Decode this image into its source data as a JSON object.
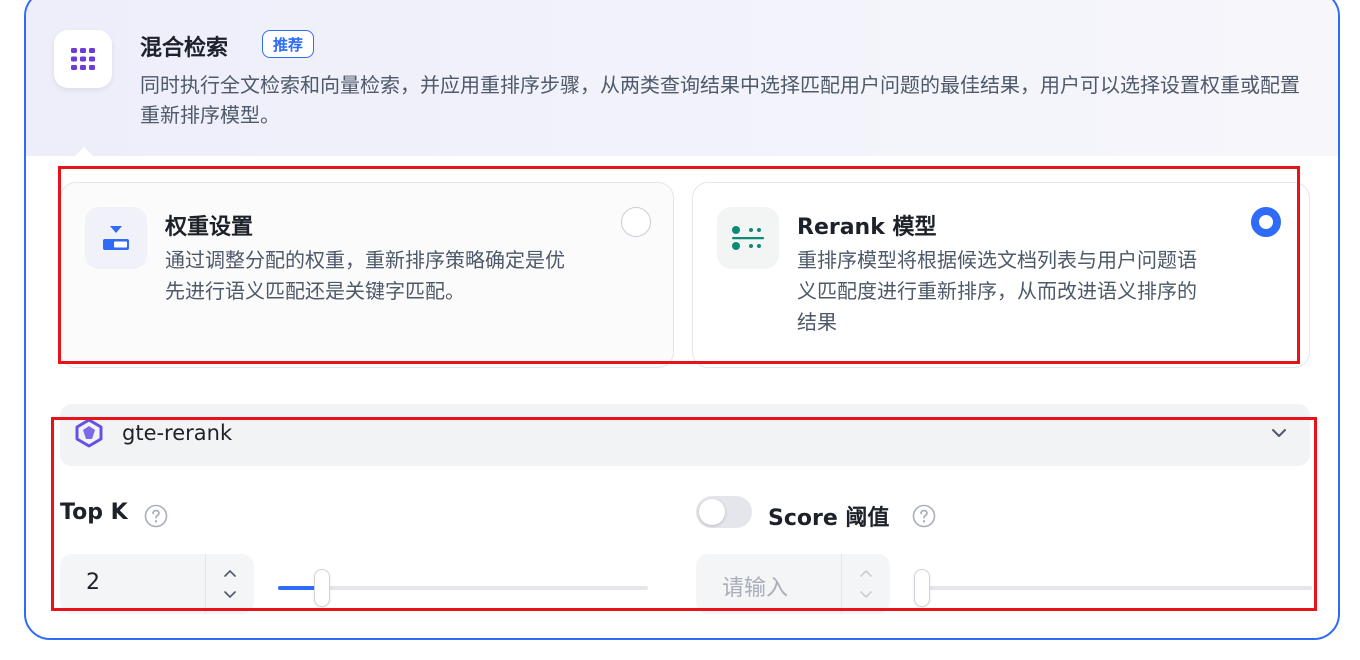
{
  "section": {
    "title": "混合检索",
    "badge": "推荐",
    "description": "同时执行全文检索和向量检索，并应用重排序步骤，从两类查询结果中选择匹配用户问题的最佳结果，用户可以选择设置权重或配置重新排序模型。"
  },
  "options": [
    {
      "title": "权重设置",
      "description_line1": "通过调整分配的权重，重新排序策略确定是优",
      "description_line2": "先进行语义匹配还是关键字匹配。",
      "selected": false
    },
    {
      "title": "Rerank 模型",
      "description_line1": "重排序模型将根据候选文档列表与用户问题语",
      "description_line2": "义匹配度进行重新排序，从而改进语义排序的",
      "description_line3": "结果",
      "selected": true
    }
  ],
  "model_select": {
    "value": "gte-rerank",
    "icon": "model-logo-icon"
  },
  "top_k": {
    "label": "Top K",
    "value": "2",
    "slider_fraction": 0.12
  },
  "score_threshold": {
    "label": "Score 阈值",
    "placeholder": "请输入",
    "enabled": false,
    "slider_fraction": 0.0
  },
  "colors": {
    "accent": "#2e6bf6",
    "annotation": "#e8121b",
    "rerank_icon": "#0b8c78",
    "weight_icon": "#2e6bf6",
    "hybrid_icon": "#6c3bd9"
  }
}
